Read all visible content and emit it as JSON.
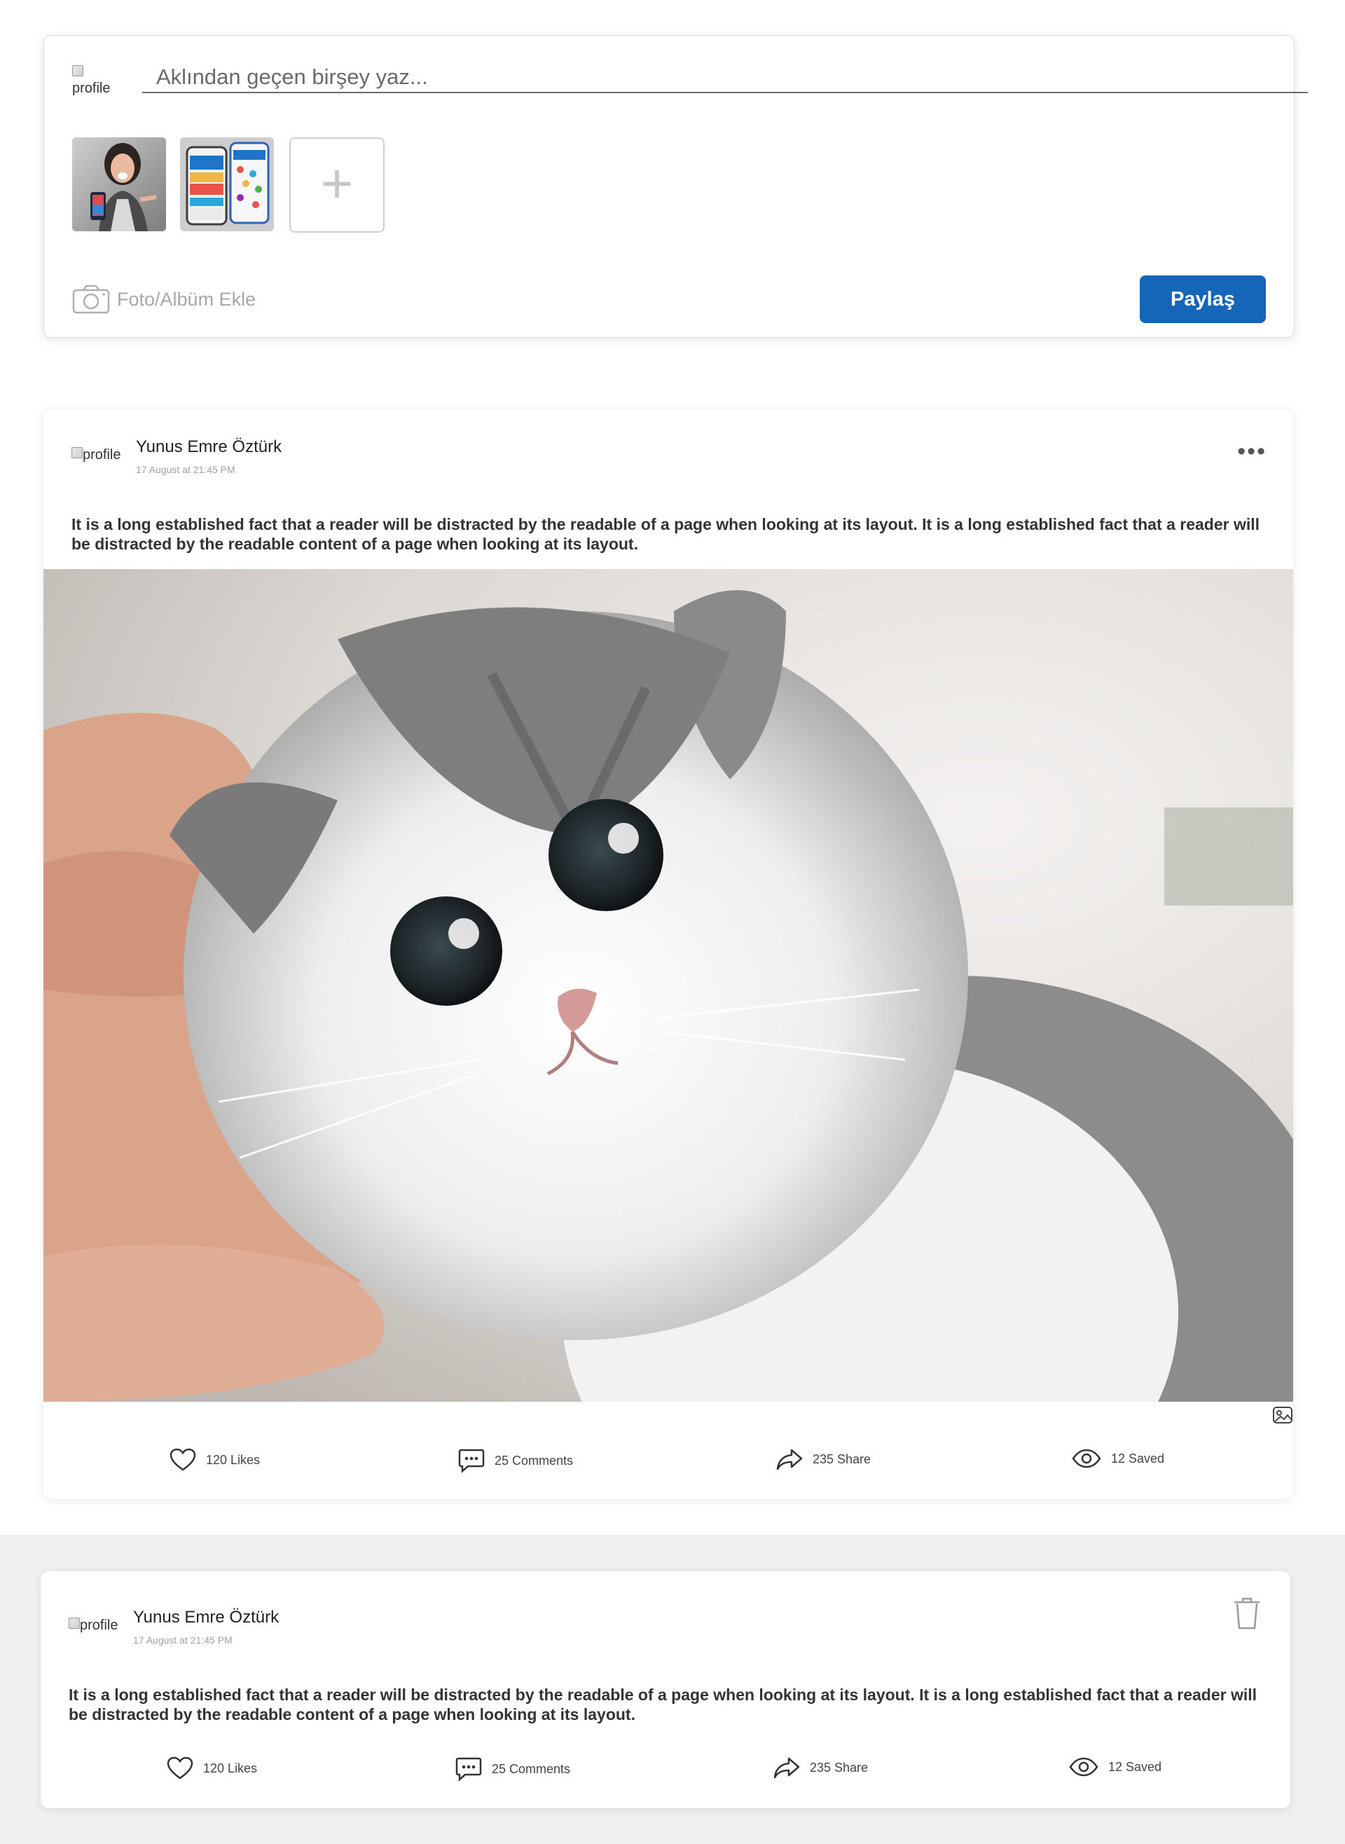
{
  "composer": {
    "avatar_alt": "profile",
    "placeholder": "Aklından geçen birşey yaz...",
    "add_media_label": "Foto/Albüm Ekle",
    "share_label": "Paylaş",
    "icons": {
      "camera": "camera-icon",
      "add": "plus-icon"
    }
  },
  "posts": [
    {
      "avatar_alt": "profile",
      "author": "Yunus Emre Öztürk",
      "time": "17 August at 21:45 PM",
      "text": "It is a long established fact that a reader will be distracted by the readable of a page when looking at its layout. It is a long established fact that a reader will be distracted by the readable content of a page when looking at its layout.",
      "menu_icon": "more-horizontal-icon",
      "stats": {
        "likes": "120 Likes",
        "comments": "25 Comments",
        "share": "235 Share",
        "saved": "12 Saved"
      }
    },
    {
      "avatar_alt": "profile",
      "author": "Yunus Emre Öztürk",
      "time": "17 August at 21:45 PM",
      "text": "It is a long established fact that a reader will be distracted by the readable of a page when looking at its layout. It is a long established fact that a reader will be distracted by the readable content of a page when looking at its layout.",
      "menu_icon": "trash-icon",
      "stats": {
        "likes": "120 Likes",
        "comments": "25 Comments",
        "share": "235 Share",
        "saved": "12 Saved"
      }
    }
  ],
  "colors": {
    "primary": "#1565b8",
    "background_band": "#f0f0f0",
    "muted_text": "#a0a0a0"
  }
}
